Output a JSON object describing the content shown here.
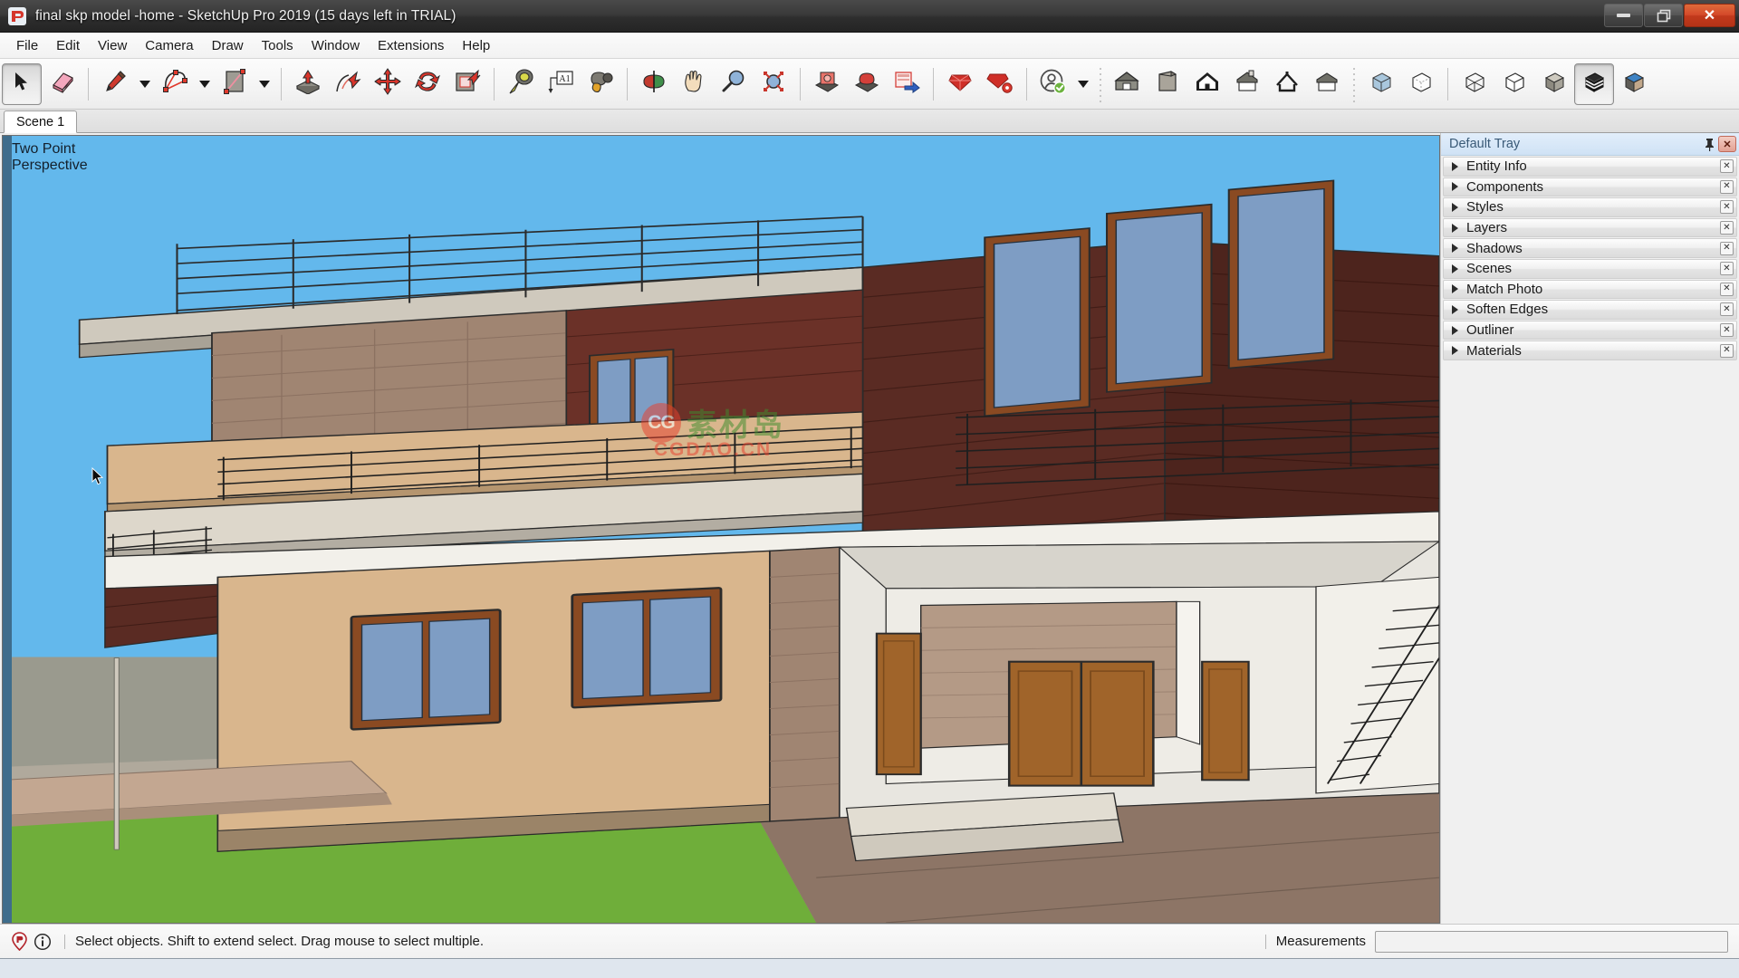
{
  "window": {
    "title": "final skp model -home - SketchUp Pro 2019 (15 days left in TRIAL)",
    "app_icon": "sketchup-logo-icon",
    "controls": {
      "minimize_label": "Minimize",
      "restore_label": "Restore",
      "close_label": "Close"
    }
  },
  "menubar": {
    "items": [
      {
        "label": "File"
      },
      {
        "label": "Edit"
      },
      {
        "label": "View"
      },
      {
        "label": "Camera"
      },
      {
        "label": "Draw"
      },
      {
        "label": "Tools"
      },
      {
        "label": "Window"
      },
      {
        "label": "Extensions"
      },
      {
        "label": "Help"
      }
    ]
  },
  "toolbar": {
    "groups": [
      {
        "name": "principal-tools",
        "buttons": [
          {
            "icon": "select-arrow-icon",
            "label": "Select",
            "active": true
          },
          {
            "icon": "eraser-icon",
            "label": "Eraser",
            "active": false
          }
        ]
      },
      {
        "name": "drawing-tools",
        "buttons": [
          {
            "icon": "pencil-line-icon",
            "label": "Line",
            "active": false
          },
          {
            "icon": "chevron-down-icon",
            "label": "Line options",
            "active": false,
            "dropdown": true
          },
          {
            "icon": "arc-icon",
            "label": "Arc",
            "active": false
          },
          {
            "icon": "chevron-down-icon",
            "label": "Arc options",
            "active": false,
            "dropdown": true
          },
          {
            "icon": "rectangle-icon",
            "label": "Rectangle",
            "active": false
          },
          {
            "icon": "chevron-down-icon",
            "label": "Shape options",
            "active": false,
            "dropdown": true
          }
        ]
      },
      {
        "name": "modification-tools",
        "buttons": [
          {
            "icon": "push-pull-icon",
            "label": "Push/Pull",
            "active": false
          },
          {
            "icon": "follow-me-icon",
            "label": "Follow Me",
            "active": false
          },
          {
            "icon": "move-icon",
            "label": "Move",
            "active": false
          },
          {
            "icon": "rotate-icon",
            "label": "Rotate",
            "active": false
          },
          {
            "icon": "offset-icon",
            "label": "Offset",
            "active": false
          }
        ]
      },
      {
        "name": "construction-tools",
        "buttons": [
          {
            "icon": "tape-measure-icon",
            "label": "Tape Measure",
            "active": false
          },
          {
            "icon": "text-tool-icon",
            "label": "Text",
            "active": false
          },
          {
            "icon": "paint-bucket-icon",
            "label": "Paint Bucket",
            "active": false
          }
        ]
      },
      {
        "name": "camera-tools",
        "buttons": [
          {
            "icon": "orbit-icon",
            "label": "Orbit",
            "active": false
          },
          {
            "icon": "pan-hand-icon",
            "label": "Pan",
            "active": false
          },
          {
            "icon": "zoom-magnifier-icon",
            "label": "Zoom",
            "active": false
          },
          {
            "icon": "zoom-extents-icon",
            "label": "Zoom Extents",
            "active": false
          }
        ]
      },
      {
        "name": "warehouse-tools",
        "buttons": [
          {
            "icon": "get-models-icon",
            "label": "3D Warehouse",
            "active": false
          },
          {
            "icon": "share-model-icon",
            "label": "Share Model",
            "active": false
          },
          {
            "icon": "share-component-icon",
            "label": "Share Component",
            "active": false
          }
        ]
      },
      {
        "name": "extension-tools",
        "buttons": [
          {
            "icon": "extension-warehouse-icon",
            "label": "Extension Warehouse",
            "active": false
          },
          {
            "icon": "extension-manager-icon",
            "label": "Extension Manager",
            "active": false
          }
        ]
      },
      {
        "name": "account-tools",
        "buttons": [
          {
            "icon": "user-account-icon",
            "label": "Signed in",
            "active": false
          },
          {
            "icon": "chevron-down-icon",
            "label": "Account menu",
            "active": false,
            "dropdown": true
          }
        ]
      },
      {
        "name": "views-toolbar",
        "buttons": [
          {
            "icon": "view-iso-icon",
            "label": "Iso",
            "active": false
          },
          {
            "icon": "view-top-icon",
            "label": "Top",
            "active": false
          },
          {
            "icon": "view-front-icon",
            "label": "Front",
            "active": false
          },
          {
            "icon": "view-right-icon",
            "label": "Right",
            "active": false
          },
          {
            "icon": "view-back-icon",
            "label": "Back",
            "active": false
          },
          {
            "icon": "view-left-icon",
            "label": "Left",
            "active": false
          }
        ]
      },
      {
        "name": "styles-toolbar",
        "buttons": [
          {
            "icon": "style-xray-icon",
            "label": "X-ray",
            "active": false
          },
          {
            "icon": "style-backedges-icon",
            "label": "Back Edges",
            "active": false
          },
          {
            "icon": "style-wireframe-icon",
            "label": "Wireframe",
            "active": false
          },
          {
            "icon": "style-hiddenline-icon",
            "label": "Hidden Line",
            "active": false
          },
          {
            "icon": "style-shaded-icon",
            "label": "Shaded",
            "active": false
          },
          {
            "icon": "style-shaded-textures-icon",
            "label": "Shaded With Textures",
            "active": true
          },
          {
            "icon": "style-monochrome-icon",
            "label": "Monochrome",
            "active": false
          }
        ]
      }
    ]
  },
  "scene_tabs": {
    "tabs": [
      {
        "label": "Scene 1",
        "active": true
      }
    ]
  },
  "viewport": {
    "camera_label": "Two Point\nPerspective",
    "sky_color": "#63b8ec",
    "ground_color": "#9a9a8e",
    "grass_color": "#6fae3a",
    "wall_tan_color": "#d9b68d",
    "wall_dark_wood_color": "#5a2b23",
    "wall_mid_wood_color": "#7a3a2c",
    "brick_color": "#a08572",
    "window_glass_color": "#7e9dc4",
    "window_frame_color": "#8a4a22",
    "door_wood_color": "#a0642a",
    "interior_wall_color": "#e8e6e0",
    "paving_color": "#8d7566",
    "watermark": {
      "badge_text": "CG",
      "cn_text": "素材岛",
      "sub_text": "CGDAO.CN",
      "badge_color": "#e8412e",
      "cn_color": "#3f8c2e"
    }
  },
  "tray": {
    "title": "Default Tray",
    "pin_icon": "pin-icon",
    "close_icon": "close-icon",
    "close_glyph": "✕",
    "panel_close_glyph": "✕",
    "panels": [
      {
        "label": "Entity Info",
        "expanded": false
      },
      {
        "label": "Components",
        "expanded": false
      },
      {
        "label": "Styles",
        "expanded": false
      },
      {
        "label": "Layers",
        "expanded": false
      },
      {
        "label": "Shadows",
        "expanded": false
      },
      {
        "label": "Scenes",
        "expanded": false
      },
      {
        "label": "Match Photo",
        "expanded": false
      },
      {
        "label": "Soften Edges",
        "expanded": false
      },
      {
        "label": "Outliner",
        "expanded": false
      },
      {
        "label": "Materials",
        "expanded": false
      }
    ]
  },
  "statusbar": {
    "help_icon": "sketchup-badge-icon",
    "info_icon": "info-circle-icon",
    "message": "Select objects. Shift to extend select. Drag mouse to select multiple.",
    "measurements_label": "Measurements",
    "measurements_value": "",
    "measurements_placeholder": ""
  }
}
